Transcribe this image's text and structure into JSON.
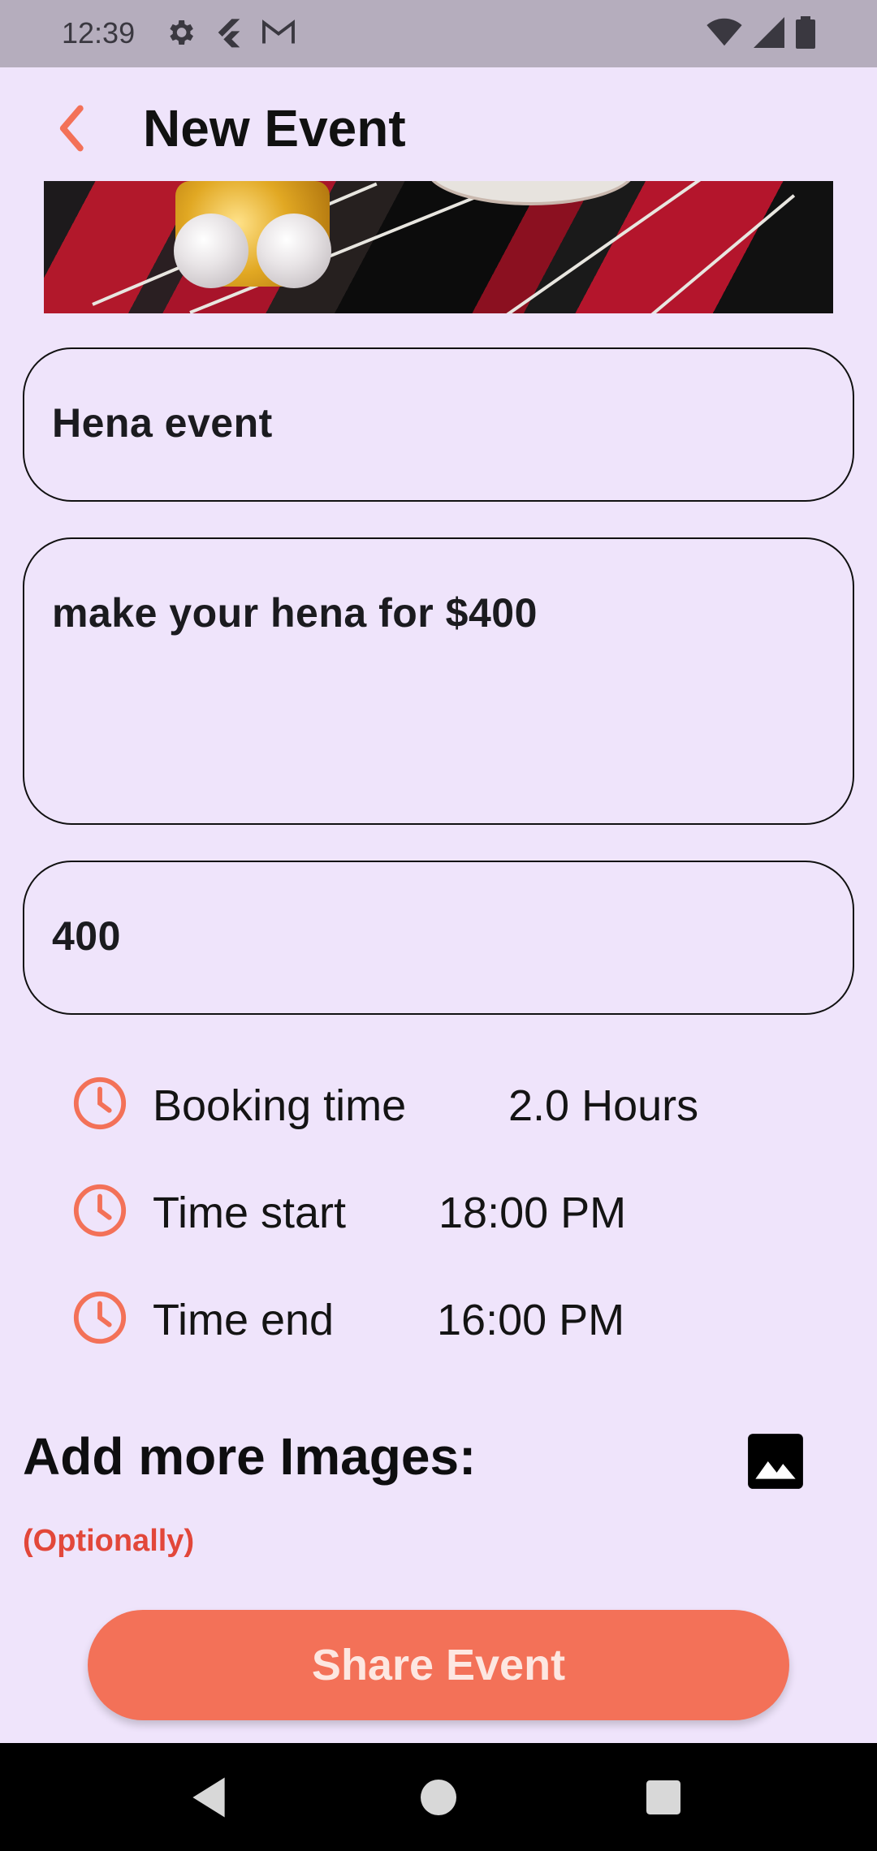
{
  "status_bar": {
    "time": "12:39",
    "left_icons": [
      "settings-icon",
      "flutter-icon",
      "gmail-icon"
    ],
    "right_icons": [
      "wifi-icon",
      "signal-icon",
      "battery-icon"
    ]
  },
  "header": {
    "title": "New Event",
    "back_icon": "chevron-left-icon"
  },
  "form": {
    "event_name": "Hena event",
    "description": "make your hena for $400",
    "price": "400"
  },
  "times": [
    {
      "label": "Booking time",
      "value": "2.0 Hours"
    },
    {
      "label": "Time start",
      "value": "18:00 PM"
    },
    {
      "label": "Time end",
      "value": "16:00 PM"
    }
  ],
  "images_section": {
    "title": "Add more Images:",
    "note": "(Optionally)",
    "icon": "image-icon"
  },
  "share_button": "Share Event",
  "colors": {
    "accent": "#f37158",
    "background": "#efe4fb",
    "optional_text": "#e2473a"
  }
}
